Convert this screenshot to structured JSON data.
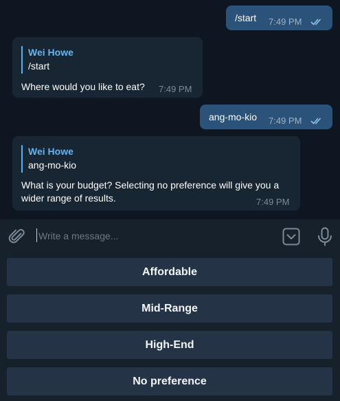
{
  "messages": {
    "m1": {
      "text": "/start",
      "time": "7:49 PM"
    },
    "m2": {
      "reply_name": "Wei Howe",
      "reply_text": "/start",
      "text": "Where would you like to eat?",
      "time": "7:49 PM"
    },
    "m3": {
      "text": "ang-mo-kio",
      "time": "7:49 PM"
    },
    "m4": {
      "reply_name": "Wei Howe",
      "reply_text": "ang-mo-kio",
      "text_line1": "What is your budget? Selecting no preference will give you a",
      "text_line2": "wider range of results.",
      "time": "7:49 PM"
    }
  },
  "composer": {
    "placeholder": "Write a message..."
  },
  "keyboard": {
    "buttons": [
      "Affordable",
      "Mid-Range",
      "High-End",
      "No preference"
    ]
  },
  "icons": {
    "attach": "paperclip-icon",
    "keyboard": "keyboard-toggle-icon",
    "mic": "microphone-icon",
    "read": "double-check-icon"
  },
  "colors": {
    "background": "#0e1621",
    "outgoing_bubble": "#2b5278",
    "incoming_bubble": "#182533",
    "accent": "#64b5ef",
    "panel": "#17212b",
    "keyboard_button": "#243446"
  }
}
